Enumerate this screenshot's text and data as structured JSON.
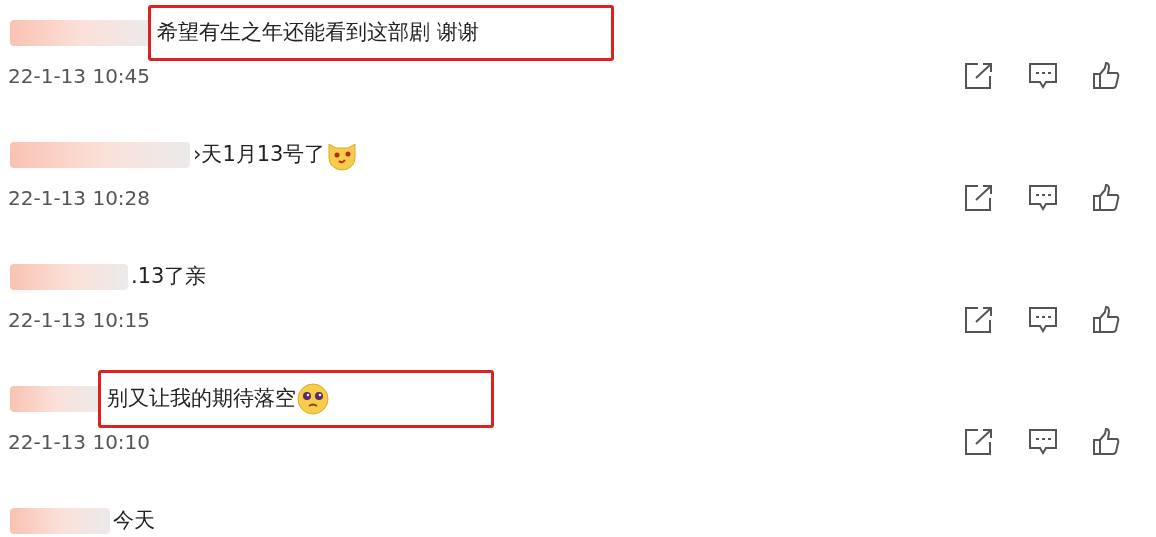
{
  "comments": [
    {
      "kind": "plain",
      "text": "希望有生之年还能看到这部剧 谢谢",
      "time": "22-1-13 10:45",
      "highlighted": true
    },
    {
      "kind": "cat",
      "text": "›天1月13号了",
      "time": "22-1-13 10:28",
      "highlighted": false
    },
    {
      "kind": "plain",
      "text": ".13了亲",
      "time": "22-1-13 10:15",
      "highlighted": false
    },
    {
      "kind": "pleading",
      "text": "别又让我的期待落空",
      "time": "22-1-13 10:10",
      "highlighted": true
    },
    {
      "kind": "plain",
      "text": "今天",
      "highlighted": false
    }
  ]
}
